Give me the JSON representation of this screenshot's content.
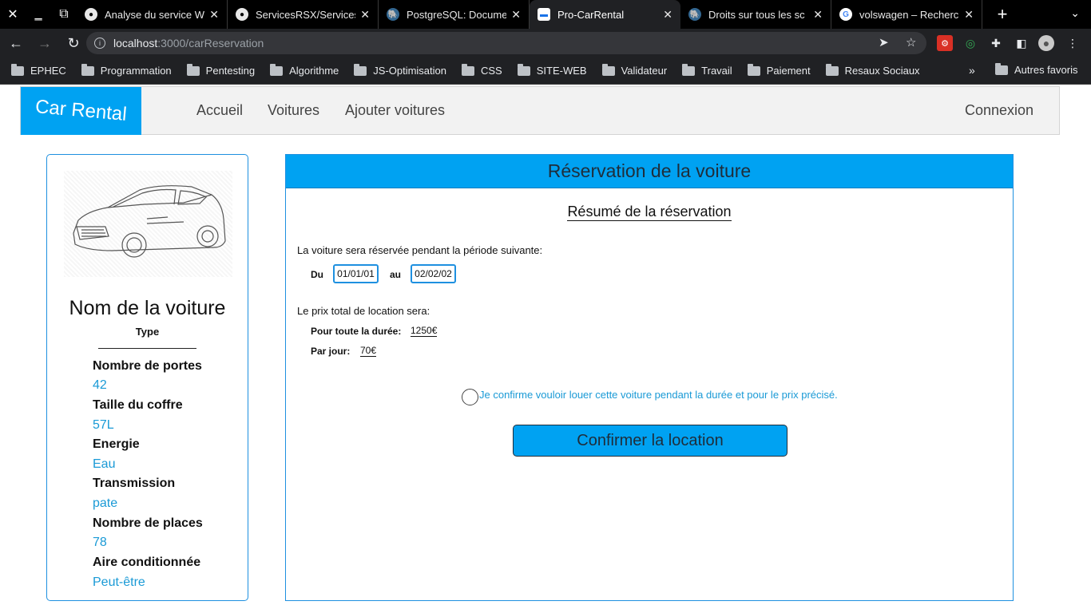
{
  "browser": {
    "tabs": [
      {
        "title": "Analyse du service W",
        "icon": "github-icon",
        "active": false
      },
      {
        "title": "ServicesRSX/Services",
        "icon": "github-icon",
        "active": false
      },
      {
        "title": "PostgreSQL: Docume",
        "icon": "postgresql-icon",
        "active": false
      },
      {
        "title": "Pro-CarRental",
        "icon": "car-icon",
        "active": true
      },
      {
        "title": "Droits sur tous les sc",
        "icon": "postgresql-icon",
        "active": false
      },
      {
        "title": "volswagen – Recherc",
        "icon": "google-icon",
        "active": false
      }
    ],
    "url_host": "localhost",
    "url_path": ":3000/carReservation",
    "bookmarks": [
      "EPHEC",
      "Programmation",
      "Pentesting",
      "Algorithme",
      "JS-Optimisation",
      "CSS",
      "SITE-WEB",
      "Validateur",
      "Travail",
      "Paiement",
      "Resaux Sociaux"
    ],
    "other_bookmarks": "Autres favoris"
  },
  "nav": {
    "logo": "Car Rental",
    "links": [
      "Accueil",
      "Voitures",
      "Ajouter voitures"
    ],
    "login": "Connexion"
  },
  "car": {
    "name": "Nom de la voiture",
    "type": "Type",
    "specs": [
      {
        "label": "Nombre de portes",
        "value": "42"
      },
      {
        "label": "Taille du coffre",
        "value": "57L"
      },
      {
        "label": "Energie",
        "value": "Eau"
      },
      {
        "label": "Transmission",
        "value": "pate"
      },
      {
        "label": "Nombre de places",
        "value": "78"
      },
      {
        "label": "Aire conditionnée",
        "value": "Peut-être"
      }
    ]
  },
  "reservation": {
    "header": "Réservation de la voiture",
    "summary_title": "Résumé de la réservation",
    "period_text": "La voiture sera réservée pendant la période suivante:",
    "from_label": "Du",
    "from_value": "01/01/01",
    "to_label": "au",
    "to_value": "02/02/02",
    "price_text": "Le prix total de location sera:",
    "total_label": "Pour toute la durée:",
    "total_value": "1250€",
    "daily_label": "Par jour:",
    "daily_value": "70€",
    "confirm_checkbox": "Je confirme vouloir louer cette voiture pendant la durée et pour le prix précisé.",
    "confirm_button": "Confirmer la location"
  },
  "colors": {
    "accent": "#00a2f2",
    "border": "#1e90e0",
    "value_text": "#1a9ad6"
  }
}
